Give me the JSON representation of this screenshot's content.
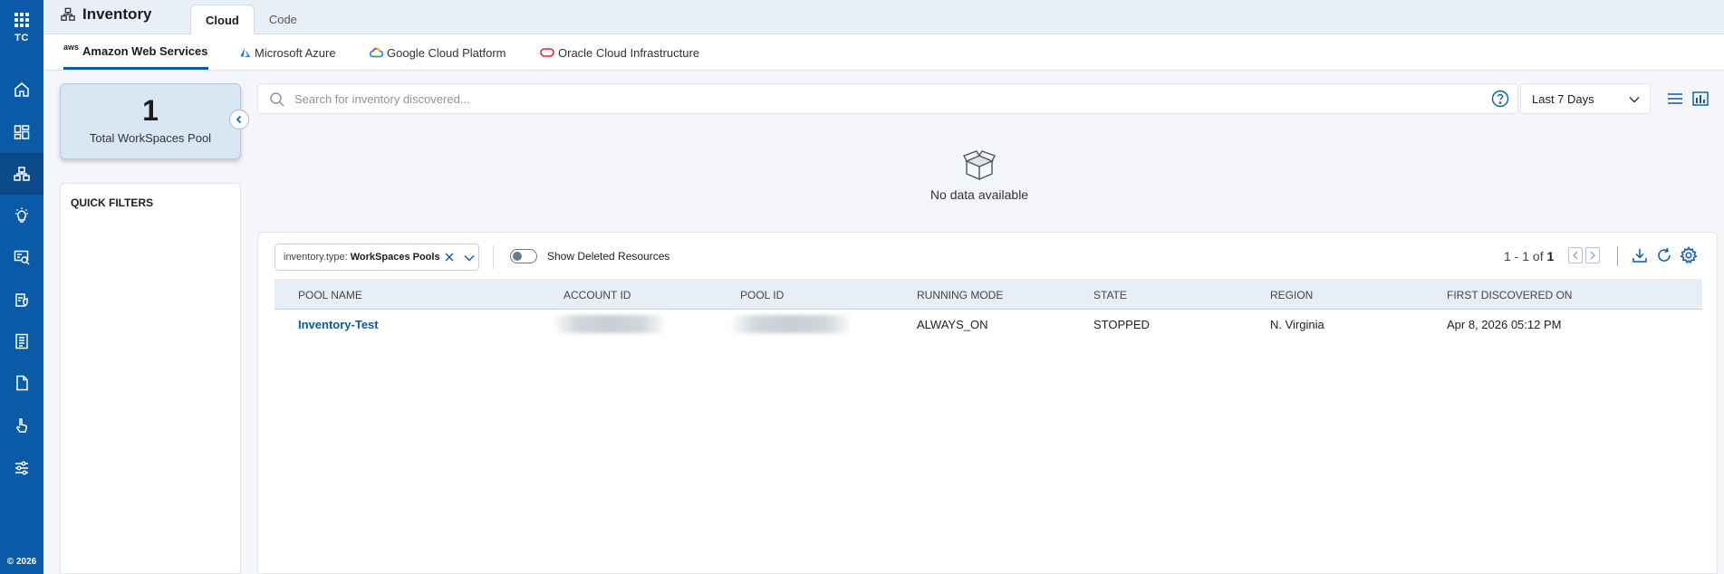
{
  "rail": {
    "apps_label": "TC",
    "copyright": "© 2026",
    "nav": [
      "home-icon",
      "dashboard-icon",
      "inventory-icon",
      "insights-bulb-icon",
      "search-report-icon",
      "compliance-icon",
      "reports-icon",
      "document-icon",
      "hand-pointer-icon",
      "settings-sliders-icon"
    ]
  },
  "header": {
    "title": "Inventory",
    "tabs": [
      {
        "label": "Cloud",
        "active": true
      },
      {
        "label": "Code",
        "active": false
      }
    ]
  },
  "clouds": [
    {
      "label": "Amazon Web Services",
      "logo_text": "aws",
      "active": true
    },
    {
      "label": "Microsoft Azure",
      "active": false
    },
    {
      "label": "Google Cloud Platform",
      "active": false
    },
    {
      "label": "Oracle Cloud Infrastructure",
      "active": false
    }
  ],
  "summary": {
    "count": "1",
    "label": "Total WorkSpaces Pool"
  },
  "quick_filters": {
    "heading": "QUICK FILTERS"
  },
  "search": {
    "placeholder": "Search for inventory discovered...",
    "value": ""
  },
  "date_range": {
    "selected": "Last 7 Days"
  },
  "empty_state": {
    "text": "No data available"
  },
  "filter_chip": {
    "key": "inventory.type:",
    "value": "WorkSpaces Pools"
  },
  "show_deleted": {
    "label": "Show Deleted Resources",
    "on": false
  },
  "pagination": {
    "range": "1 - 1 of",
    "total": "1"
  },
  "table": {
    "columns": [
      "POOL NAME",
      "ACCOUNT ID",
      "POOL ID",
      "RUNNING MODE",
      "STATE",
      "REGION",
      "FIRST DISCOVERED ON"
    ],
    "rows": [
      {
        "pool_name": "Inventory-Test",
        "running_mode": "ALWAYS_ON",
        "state": "STOPPED",
        "region": "N. Virginia",
        "first_discovered": "Apr 8, 2026 05:12 PM"
      }
    ]
  },
  "colors": {
    "rail": "#0a5aa8",
    "accent": "#0a5aa8",
    "kpi_bg": "#d9e6f3"
  }
}
